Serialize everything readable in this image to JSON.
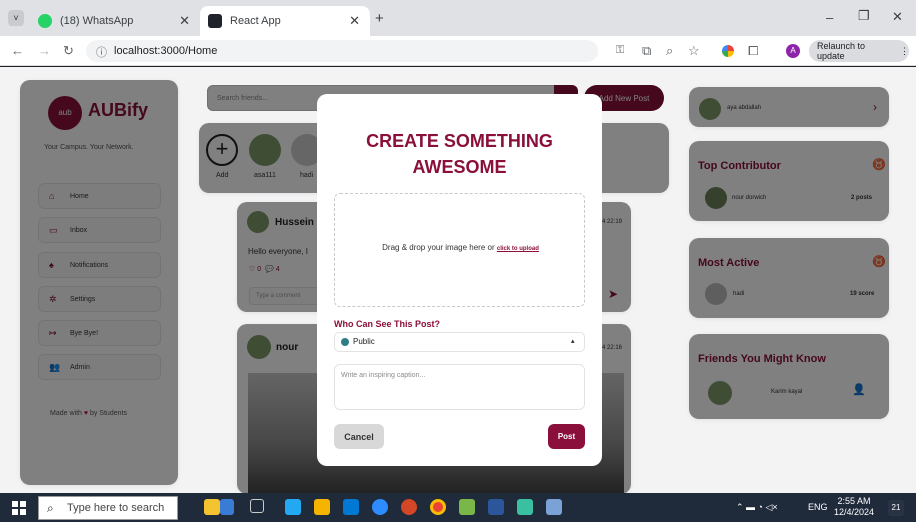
{
  "browser": {
    "tabs": [
      {
        "label": "(18) WhatsApp",
        "fav_color": "#25d366"
      },
      {
        "label": "React App",
        "fav_color": "#20232a"
      }
    ],
    "url": "localhost:3000/Home",
    "profile_letter": "A",
    "relaunch_label": "Relaunch to update"
  },
  "sidebar": {
    "logo_text": "AUBify",
    "logo_mark": "aub",
    "tagline": "Your Campus. Your Network.",
    "items": [
      {
        "label": "Home",
        "icon": "home-icon"
      },
      {
        "label": "Inbox",
        "icon": "inbox-icon"
      },
      {
        "label": "Notifications",
        "icon": "bell-icon"
      },
      {
        "label": "Settings",
        "icon": "gear-icon"
      },
      {
        "label": "Bye Bye!",
        "icon": "logout-icon"
      },
      {
        "label": "Admin",
        "icon": "admin-icon"
      }
    ],
    "footer_prefix": "Made with",
    "footer_suffix": "by Students"
  },
  "feed": {
    "search_placeholder": "Search friends...",
    "add_post_label": "Add New Post",
    "stories": [
      {
        "label": "Add"
      },
      {
        "label": "asa111"
      },
      {
        "label": "hadi"
      }
    ],
    "posts": [
      {
        "author": "Hussein",
        "time": "4 22:19",
        "text": "Hello everyone, I",
        "likes": "0",
        "comments": "4",
        "comment_placeholder": "Type a comment"
      },
      {
        "author": "nour",
        "time": "4 22:16"
      }
    ]
  },
  "right": {
    "profile_name": "aya abdallah",
    "top_contributor": {
      "title": "Top Contributor",
      "name": "nour dorwich",
      "value": "2 posts"
    },
    "most_active": {
      "title": "Most Active",
      "name": "hadi",
      "value": "19 score"
    },
    "suggest": {
      "title": "Friends You Might Know",
      "name": "Karim kayal"
    }
  },
  "modal": {
    "title_line1": "CREATE SOMETHING",
    "title_line2": "AWESOME",
    "drop_text": "Drag & drop your image here or",
    "drop_link": "click to upload",
    "visibility_label": "Who Can See This Post?",
    "visibility_value": "Public",
    "caption_placeholder": "Write an inspiring caption...",
    "cancel_label": "Cancel",
    "post_label": "Post"
  },
  "taskbar": {
    "search_placeholder": "Type here to search",
    "lang": "ENG",
    "time": "2:55 AM",
    "date": "12/4/2024",
    "notif_count": "21"
  },
  "colors": {
    "accent": "#8a0f3a",
    "page_bg": "#f3f3f4"
  }
}
